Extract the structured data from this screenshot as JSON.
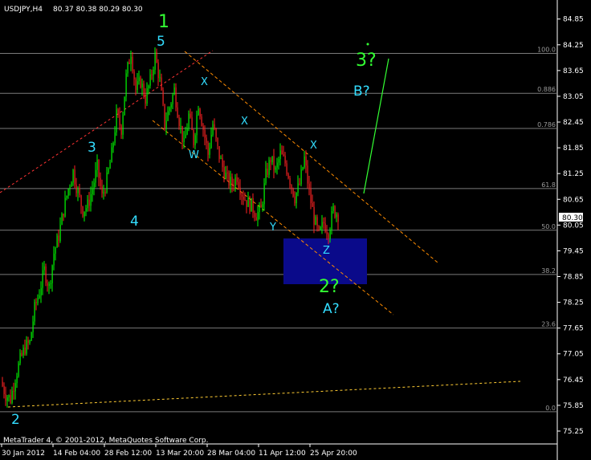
{
  "header": {
    "symbol": "USDJPY,H4",
    "ohlc": "80.37 80.38 80.29 80.30"
  },
  "footer": "MetaTrader 4, © 2001-2012, MetaQuotes Software Corp.",
  "price_marker": "80.30",
  "colors": {
    "bull": "#00ff00",
    "bear": "#ff2222",
    "fib": "#808080",
    "channel": "#ff8c00",
    "zone": "#0a0a8a",
    "wave_green": "#33ff33",
    "wave_cyan": "#33ddff"
  },
  "chart_data": {
    "type": "candlestick",
    "ylim": [
      75.1,
      85.2
    ],
    "y_ticks": [
      "84.85",
      "84.25",
      "83.65",
      "83.05",
      "82.45",
      "81.85",
      "81.25",
      "80.65",
      "80.05",
      "79.45",
      "78.85",
      "78.25",
      "77.65",
      "77.05",
      "76.45",
      "75.85",
      "75.25"
    ],
    "x_ticks": [
      "30 Jan 2012",
      "14 Feb 04:00",
      "28 Feb 12:00",
      "13 Mar 20:00",
      "28 Mar 04:00",
      "11 Apr 12:00",
      "25 Apr 20:00"
    ],
    "fib_levels": [
      {
        "label": "100.0",
        "price": 84.05
      },
      {
        "label": "0.886",
        "price": 83.12
      },
      {
        "label": "0.786",
        "price": 82.3
      },
      {
        "label": "61.8",
        "price": 80.9
      },
      {
        "label": "50.0",
        "price": 79.93
      },
      {
        "label": "38.2",
        "price": 78.9
      },
      {
        "label": "23.6",
        "price": 77.65
      },
      {
        "label": "0.0",
        "price": 75.7
      }
    ],
    "price_path": [
      [
        0,
        76.4
      ],
      [
        6,
        76.1
      ],
      [
        12,
        76.0
      ],
      [
        18,
        76.5
      ],
      [
        24,
        76.9
      ],
      [
        30,
        77.2
      ],
      [
        36,
        77.3
      ],
      [
        42,
        78.1
      ],
      [
        48,
        78.5
      ],
      [
        54,
        79.0
      ],
      [
        60,
        78.6
      ],
      [
        66,
        79.4
      ],
      [
        72,
        79.8
      ],
      [
        78,
        80.4
      ],
      [
        84,
        80.9
      ],
      [
        90,
        81.3
      ],
      [
        96,
        80.8
      ],
      [
        102,
        80.4
      ],
      [
        108,
        80.5
      ],
      [
        114,
        80.9
      ],
      [
        120,
        81.4
      ],
      [
        126,
        80.7
      ],
      [
        132,
        81.1
      ],
      [
        138,
        81.7
      ],
      [
        144,
        82.6
      ],
      [
        150,
        82.3
      ],
      [
        156,
        83.5
      ],
      [
        162,
        84.1
      ],
      [
        168,
        83.2
      ],
      [
        174,
        83.4
      ],
      [
        180,
        83.0
      ],
      [
        186,
        83.4
      ],
      [
        192,
        84.0
      ],
      [
        198,
        83.4
      ],
      [
        204,
        82.4
      ],
      [
        210,
        82.8
      ],
      [
        216,
        83.2
      ],
      [
        222,
        82.5
      ],
      [
        228,
        81.9
      ],
      [
        234,
        82.6
      ],
      [
        240,
        82.0
      ],
      [
        246,
        82.9
      ],
      [
        252,
        82.3
      ],
      [
        258,
        81.7
      ],
      [
        264,
        82.4
      ],
      [
        270,
        81.8
      ],
      [
        276,
        81.4
      ],
      [
        282,
        81.1
      ],
      [
        288,
        81.0
      ],
      [
        294,
        81.2
      ],
      [
        300,
        80.8
      ],
      [
        306,
        80.6
      ],
      [
        312,
        80.5
      ],
      [
        318,
        80.3
      ],
      [
        324,
        80.4
      ],
      [
        330,
        81.2
      ],
      [
        336,
        81.6
      ],
      [
        342,
        81.3
      ],
      [
        348,
        81.7
      ],
      [
        354,
        81.5
      ],
      [
        360,
        81.1
      ],
      [
        366,
        80.7
      ],
      [
        372,
        81.0
      ],
      [
        378,
        81.6
      ],
      [
        384,
        80.8
      ],
      [
        390,
        80.2
      ],
      [
        396,
        79.8
      ],
      [
        402,
        80.1
      ],
      [
        408,
        79.9
      ],
      [
        414,
        80.4
      ],
      [
        420,
        80.3
      ]
    ],
    "wave_labels": [
      {
        "text": "1",
        "kind": "big"
      },
      {
        "text": "5",
        "kind": "cyan"
      },
      {
        "text": "3",
        "kind": "cyan"
      },
      {
        "text": "4",
        "kind": "cyan"
      },
      {
        "text": "2",
        "kind": "cyan"
      },
      {
        "text": "3?",
        "kind": "big"
      },
      {
        "text": "B?",
        "kind": "cyan"
      },
      {
        "text": "2?",
        "kind": "big"
      },
      {
        "text": "A?",
        "kind": "cyan"
      },
      {
        "text": "X",
        "kind": "cyan-sm"
      },
      {
        "text": "X",
        "kind": "cyan-sm"
      },
      {
        "text": "X",
        "kind": "cyan-sm"
      },
      {
        "text": "W",
        "kind": "cyan-sm"
      },
      {
        "text": "Y",
        "kind": "cyan-sm"
      },
      {
        "text": "Z",
        "kind": "cyan-sm"
      }
    ]
  }
}
